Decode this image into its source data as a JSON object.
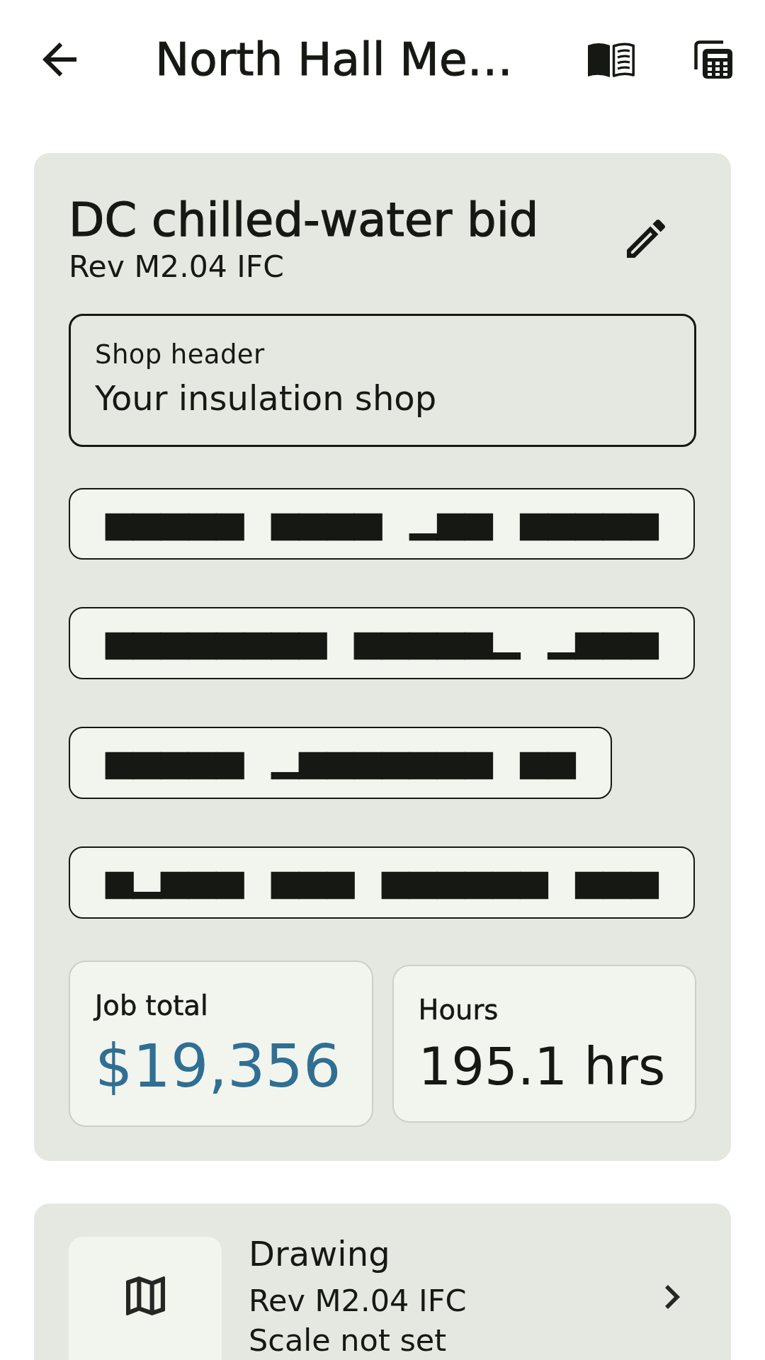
{
  "top_bar": {
    "title": "North Hall Me…"
  },
  "estimate_card": {
    "title": "DC chilled-water bid",
    "revision": "Rev M2.04 IFC",
    "shop_header_field": {
      "label": "Shop header",
      "value": "Your insulation shop"
    },
    "chips": [
      {
        "label": "▄▄▄▄▄ ▄▄▄▄ ▁▄▄ ▄▄▄▄▄"
      },
      {
        "label": "▄▄▄▄▄▄▄▄ ▄▄▄▄▄▁ ▁▄▄▄"
      },
      {
        "label": "▄▄▄▄▄ ▁▄▄▄▄▄▄▄ ▄▄"
      },
      {
        "label": "▄▁▄▄▄ ▄▄▄ ▄▄▄▄▄▄ ▄▄▄"
      }
    ],
    "stats": [
      {
        "label": "Job total",
        "value": "$19,356",
        "accent": true
      },
      {
        "label": "Hours",
        "value": "195.1 hrs",
        "accent": false
      }
    ]
  },
  "drawing_card": {
    "title": "Drawing",
    "lines": [
      "Rev M2.04 IFC",
      "Scale not set"
    ]
  }
}
